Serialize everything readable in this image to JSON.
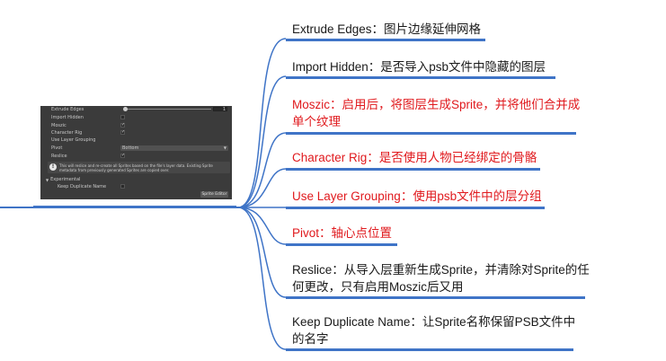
{
  "inspector": {
    "extrude_edges_label": "Extrude Edges",
    "extrude_edges_value": "1",
    "import_hidden_label": "Import Hidden",
    "moszic_label": "Moszic",
    "character_rig_label": "Character Rig",
    "use_layer_grouping_label": "Use Layer Grouping",
    "pivot_label": "Pivot",
    "pivot_value": "Bottom",
    "reslice_label": "Reslice",
    "info_text": "This will reslice and re-create all Sprites based on the file's layer data. Existing Sprite metadata from previously generated Sprites are copied over.",
    "experimental_label": "Experimental",
    "keep_duplicate_name_label": "Keep Duplicate Name",
    "sprite_editor_button": "Sprite Editor"
  },
  "nodes": [
    {
      "text": "Extrude Edges：图片边缘延伸网格",
      "color": "#1a1a1a"
    },
    {
      "text": "Import Hidden：是否导入psb文件中隐藏的图层",
      "color": "#1a1a1a"
    },
    {
      "line1": "Moszic：启用后，将图层生成Sprite，并将他们合并成",
      "line2": "单个纹理",
      "color": "#e0191d"
    },
    {
      "text": "Character Rig：是否使用人物已经绑定的骨骼",
      "color": "#e0191d"
    },
    {
      "text": "Use Layer Grouping：使用psb文件中的层分组",
      "color": "#e0191d"
    },
    {
      "text": "Pivot：轴心点位置",
      "color": "#e0191d"
    },
    {
      "line1": "Reslice：从导入层重新生成Sprite，并清除对Sprite的任",
      "line2": "何更改，只有启用Moszic后又用",
      "color": "#1a1a1a"
    },
    {
      "line1": "Keep Duplicate Name：让Sprite名称保留PSB文件中",
      "line2": "的名字",
      "color": "#1a1a1a"
    }
  ],
  "colors": {
    "link": "#3f74c7",
    "red": "#e0191d",
    "panel": "#3b3b3b"
  }
}
